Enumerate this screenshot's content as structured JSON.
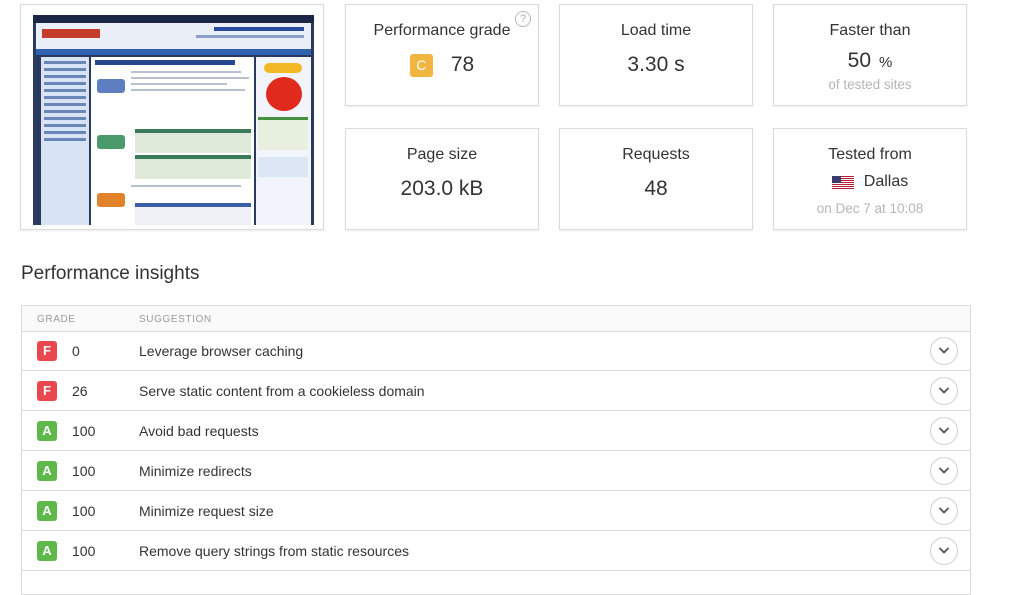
{
  "thumbnail": {
    "alt": "Website screenshot"
  },
  "metrics": {
    "grade": {
      "label": "Performance grade",
      "letter": "C",
      "value": "78",
      "badge_color": "#f2b540"
    },
    "load_time": {
      "label": "Load time",
      "value": "3.30 s"
    },
    "faster_than": {
      "label": "Faster than",
      "value": "50",
      "unit": "%",
      "sub": "of tested sites"
    },
    "page_size": {
      "label": "Page size",
      "value": "203.0 kB"
    },
    "requests": {
      "label": "Requests",
      "value": "48"
    },
    "tested_from": {
      "label": "Tested from",
      "location": "Dallas",
      "flag": "us-flag-icon",
      "sub": "on Dec 7 at 10:08"
    }
  },
  "insights": {
    "title": "Performance insights",
    "headers": {
      "grade": "GRADE",
      "suggestion": "SUGGESTION"
    },
    "rows": [
      {
        "letter": "F",
        "score": "0",
        "suggestion": "Leverage browser caching"
      },
      {
        "letter": "F",
        "score": "26",
        "suggestion": "Serve static content from a cookieless domain"
      },
      {
        "letter": "A",
        "score": "100",
        "suggestion": "Avoid bad requests"
      },
      {
        "letter": "A",
        "score": "100",
        "suggestion": "Minimize redirects"
      },
      {
        "letter": "A",
        "score": "100",
        "suggestion": "Minimize request size"
      },
      {
        "letter": "A",
        "score": "100",
        "suggestion": "Remove query strings from static resources"
      }
    ],
    "colors": {
      "F": "#e9474d",
      "A": "#5eb84a"
    }
  }
}
